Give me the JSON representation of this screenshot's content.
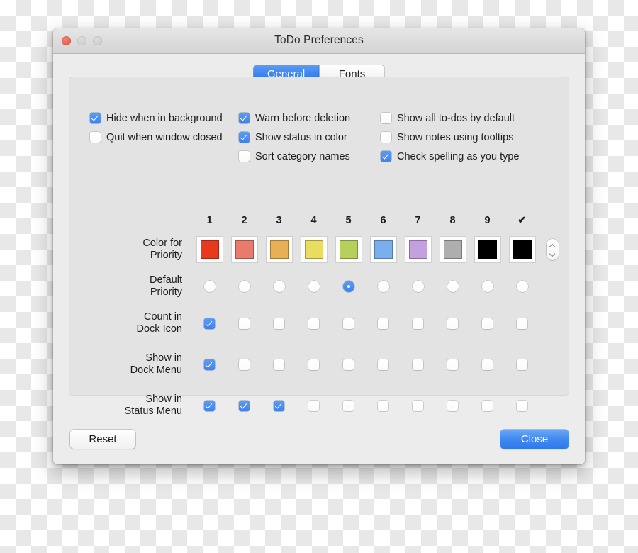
{
  "window": {
    "title": "ToDo Preferences",
    "traffic_lights": [
      {
        "name": "close",
        "color": "#e2614f",
        "enabled": true
      },
      {
        "name": "minimize",
        "color": "#cfcfcf",
        "enabled": false
      },
      {
        "name": "maximize",
        "color": "#cfcfcf",
        "enabled": false
      }
    ]
  },
  "tabs": [
    {
      "label": "General",
      "selected": true
    },
    {
      "label": "Fonts",
      "selected": false
    }
  ],
  "accent_color": "#3f82ed",
  "options": {
    "columns": [
      [
        {
          "label": "Hide when in background",
          "checked": true
        },
        {
          "label": "Quit when window closed",
          "checked": false
        }
      ],
      [
        {
          "label": "Warn before deletion",
          "checked": true
        },
        {
          "label": "Show status in color",
          "checked": true
        },
        {
          "label": "Sort category names",
          "checked": false
        }
      ],
      [
        {
          "label": "Show all to-dos by default",
          "checked": false
        },
        {
          "label": "Show notes using tooltips",
          "checked": false
        },
        {
          "label": "Check spelling as you type",
          "checked": true
        }
      ]
    ]
  },
  "matrix": {
    "column_headers": [
      "1",
      "2",
      "3",
      "4",
      "5",
      "6",
      "7",
      "8",
      "9",
      "✔"
    ],
    "rows": [
      {
        "label_line1": "Color for",
        "label_line2": "Priority",
        "type": "colors",
        "colors": [
          "#e8381e",
          "#e87b6b",
          "#e9af54",
          "#e9dc5e",
          "#b7cf5c",
          "#7baeee",
          "#c2a1de",
          "#aeaeae",
          "#000000",
          "#000000"
        ],
        "stepper": {
          "up": "▲",
          "down": "▼"
        }
      },
      {
        "label_line1": "Default",
        "label_line2": "Priority",
        "type": "radios",
        "selected_index": 4,
        "values": [
          false,
          false,
          false,
          false,
          true,
          false,
          false,
          false,
          false,
          false
        ]
      },
      {
        "label_line1": "Count in",
        "label_line2": "Dock Icon",
        "type": "checkboxes",
        "values": [
          true,
          false,
          false,
          false,
          false,
          false,
          false,
          false,
          false,
          false
        ]
      },
      {
        "label_line1": "Show in",
        "label_line2": "Dock Menu",
        "type": "checkboxes",
        "values": [
          true,
          false,
          false,
          false,
          false,
          false,
          false,
          false,
          false,
          false
        ]
      },
      {
        "label_line1": "Show in",
        "label_line2": "Status Menu",
        "type": "checkboxes",
        "values": [
          true,
          true,
          true,
          false,
          false,
          false,
          false,
          false,
          false,
          false
        ]
      }
    ]
  },
  "footer": {
    "reset_label": "Reset",
    "close_label": "Close"
  }
}
